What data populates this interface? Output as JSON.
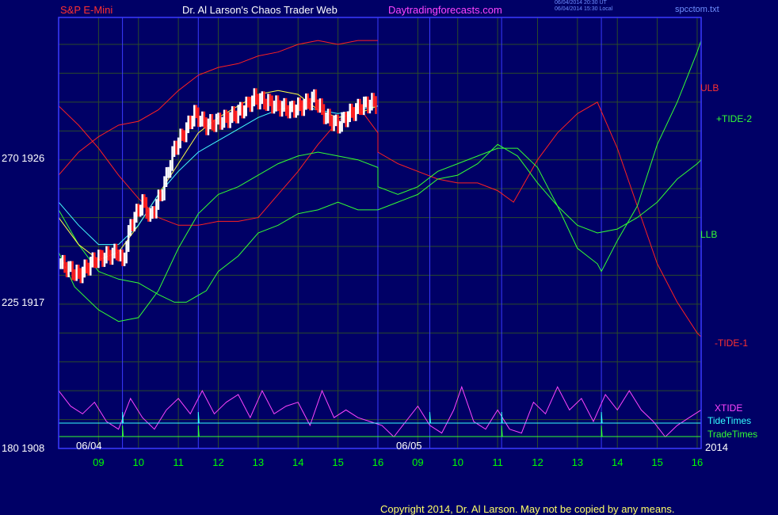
{
  "header": {
    "left_title": "S&P E-Mini",
    "center_title": "Dr. Al Larson's Chaos Trader Web",
    "site": "Daytradingforecasts.com",
    "timestamp_ut": "06/04/2014 20:30 UT",
    "timestamp_local": "06/04/2014 15:30 Local",
    "file": "spcctom.txt"
  },
  "labels": {
    "ulb": "ULB",
    "tide2": "+TIDE-2",
    "llb": "LLB",
    "tide1": "-TIDE-1",
    "xtide": "XTIDE",
    "tidetimes": "TideTimes",
    "tradetimes": "TradeTimes",
    "year": "2014",
    "date1": "06/04",
    "date2": "06/05"
  },
  "yaxis": [
    {
      "label": "270  1926",
      "value": 270
    },
    {
      "label": "225  1917",
      "value": 225
    },
    {
      "label": "180  1908",
      "value": 180
    }
  ],
  "copyright": "Copyright 2014, Dr. Al Larson. May not be copied by any means.",
  "colors": {
    "background": "#000066",
    "grid": "#2b4a2b",
    "frame": "#3a3aff",
    "ulb": "#ff2020",
    "tide2": "#33ff33",
    "llb": "#33ff33",
    "tide1": "#ff2020",
    "xtide": "#ff44ff",
    "tidetimes": "#33ffff",
    "tradetimes": "#33ff33",
    "price_up": "#ffffff",
    "price_down": "#ff2020",
    "ma_fast": "#ffff44",
    "ma_slow": "#44ffff"
  },
  "chart_data": {
    "type": "line",
    "title": "S&P E-Mini",
    "x_ticks": [
      "09",
      "10",
      "11",
      "12",
      "13",
      "14",
      "15",
      "16",
      "09",
      "10",
      "11",
      "12",
      "13",
      "14",
      "15",
      "16"
    ],
    "x_tick_hours": [
      9.0,
      10.0,
      11.0,
      12.0,
      13.0,
      14.0,
      15.0,
      16.0,
      17.0,
      18.0,
      19.0,
      20.0,
      21.0,
      22.0,
      23.0,
      24.0
    ],
    "x_range_hours": [
      8.0,
      24.1
    ],
    "y_range": [
      180,
      292
    ],
    "y_gridlines": [
      180,
      187.5,
      195,
      202.5,
      210,
      217.5,
      225,
      232.5,
      240,
      247.5,
      255,
      262.5,
      270,
      277.5,
      285
    ],
    "session_breaks_hours": [
      9.6,
      11.5,
      16.0,
      17.3,
      19.1,
      21.6
    ],
    "series": [
      {
        "name": "ULB",
        "key": "ulb",
        "points": [
          [
            8.0,
            269
          ],
          [
            8.5,
            264
          ],
          [
            9.0,
            258
          ],
          [
            9.5,
            251
          ],
          [
            10.0,
            245
          ],
          [
            10.5,
            240
          ],
          [
            11.0,
            238
          ],
          [
            11.5,
            238
          ],
          [
            12.0,
            239
          ],
          [
            12.5,
            239
          ],
          [
            13.0,
            240
          ],
          [
            13.5,
            246
          ],
          [
            14.0,
            252
          ],
          [
            14.5,
            259
          ],
          [
            15.0,
            265
          ],
          [
            15.5,
            269
          ],
          [
            16.0,
            262
          ],
          [
            16.0,
            257
          ],
          [
            16.5,
            254
          ],
          [
            17.0,
            252
          ],
          [
            17.5,
            250
          ],
          [
            18.0,
            249
          ],
          [
            18.5,
            249
          ],
          [
            19.0,
            247
          ],
          [
            19.4,
            244
          ],
          [
            20.0,
            255
          ],
          [
            20.5,
            262
          ],
          [
            21.0,
            267
          ],
          [
            21.5,
            270
          ],
          [
            22.0,
            258
          ],
          [
            22.5,
            243
          ],
          [
            23.0,
            228
          ],
          [
            23.5,
            218
          ],
          [
            24.0,
            210
          ],
          [
            24.1,
            209
          ]
        ]
      },
      {
        "name": "+TIDE-2",
        "key": "tide2",
        "points": [
          [
            8.0,
            231
          ],
          [
            8.4,
            222
          ],
          [
            9.0,
            216
          ],
          [
            9.5,
            213
          ],
          [
            10.0,
            214
          ],
          [
            10.5,
            221
          ],
          [
            11.0,
            232
          ],
          [
            11.5,
            241
          ],
          [
            12.0,
            246
          ],
          [
            12.5,
            248
          ],
          [
            13.0,
            251
          ],
          [
            13.5,
            254
          ],
          [
            14.0,
            256
          ],
          [
            14.5,
            257
          ],
          [
            15.0,
            256
          ],
          [
            15.5,
            255
          ],
          [
            16.0,
            253
          ],
          [
            16.0,
            248
          ],
          [
            16.5,
            246
          ],
          [
            17.0,
            248
          ],
          [
            17.5,
            252
          ],
          [
            18.0,
            254
          ],
          [
            18.5,
            256
          ],
          [
            19.0,
            258
          ],
          [
            19.5,
            258
          ],
          [
            20.0,
            253
          ],
          [
            20.5,
            243
          ],
          [
            21.0,
            232
          ],
          [
            21.5,
            228
          ],
          [
            21.6,
            226
          ],
          [
            22.0,
            234
          ],
          [
            22.5,
            243
          ],
          [
            23.0,
            259
          ],
          [
            23.5,
            270
          ],
          [
            24.0,
            283
          ],
          [
            24.1,
            286
          ]
        ]
      },
      {
        "name": "LLB",
        "key": "llb",
        "points": [
          [
            8.0,
            242
          ],
          [
            8.5,
            233
          ],
          [
            9.0,
            226
          ],
          [
            9.5,
            224
          ],
          [
            10.0,
            223
          ],
          [
            10.5,
            220
          ],
          [
            10.9,
            218
          ],
          [
            11.2,
            218
          ],
          [
            11.7,
            221
          ],
          [
            12.0,
            226
          ],
          [
            12.5,
            230
          ],
          [
            13.0,
            236
          ],
          [
            13.5,
            238
          ],
          [
            14.0,
            241
          ],
          [
            14.5,
            242
          ],
          [
            15.0,
            244
          ],
          [
            15.5,
            242
          ],
          [
            16.0,
            242
          ],
          [
            16.5,
            244
          ],
          [
            17.0,
            246
          ],
          [
            17.5,
            250
          ],
          [
            18.0,
            251
          ],
          [
            18.5,
            254
          ],
          [
            19.0,
            259
          ],
          [
            19.5,
            256
          ],
          [
            20.0,
            249
          ],
          [
            20.5,
            243
          ],
          [
            21.0,
            238
          ],
          [
            21.5,
            236
          ],
          [
            22.0,
            237
          ],
          [
            22.5,
            240
          ],
          [
            23.0,
            244
          ],
          [
            23.5,
            250
          ],
          [
            24.0,
            254
          ],
          [
            24.1,
            255
          ]
        ]
      },
      {
        "name": "-TIDE-1",
        "key": "tide1",
        "points": [
          [
            8.0,
            251
          ],
          [
            8.5,
            257
          ],
          [
            9.0,
            261
          ],
          [
            9.5,
            264
          ],
          [
            10.0,
            265
          ],
          [
            10.5,
            268
          ],
          [
            11.0,
            273
          ],
          [
            11.5,
            277
          ],
          [
            12.0,
            279
          ],
          [
            12.5,
            280
          ],
          [
            13.0,
            282
          ],
          [
            13.5,
            283
          ],
          [
            14.0,
            285
          ],
          [
            14.5,
            286
          ],
          [
            15.0,
            285
          ],
          [
            15.5,
            286
          ],
          [
            16.0,
            286
          ]
        ]
      },
      {
        "name": "MA fast",
        "key": "ma_fast",
        "points": [
          [
            8.0,
            240
          ],
          [
            8.5,
            233
          ],
          [
            9.0,
            229
          ],
          [
            9.5,
            231
          ],
          [
            10.0,
            238
          ],
          [
            10.5,
            246
          ],
          [
            11.0,
            254
          ],
          [
            11.5,
            262
          ],
          [
            12.0,
            266
          ],
          [
            12.5,
            269
          ],
          [
            13.0,
            272
          ],
          [
            13.5,
            273
          ],
          [
            14.0,
            272
          ],
          [
            14.5,
            268
          ],
          [
            15.0,
            266
          ],
          [
            15.5,
            267
          ],
          [
            16.0,
            269
          ]
        ]
      },
      {
        "name": "MA slow",
        "key": "ma_slow",
        "points": [
          [
            8.0,
            244
          ],
          [
            8.5,
            238
          ],
          [
            9.0,
            233
          ],
          [
            9.5,
            233
          ],
          [
            10.0,
            238
          ],
          [
            10.5,
            246
          ],
          [
            11.0,
            252
          ],
          [
            11.5,
            257
          ],
          [
            12.0,
            260
          ],
          [
            12.5,
            263
          ],
          [
            13.0,
            266
          ],
          [
            13.5,
            268
          ],
          [
            14.0,
            269
          ],
          [
            14.5,
            268
          ],
          [
            15.0,
            267
          ],
          [
            15.5,
            268
          ],
          [
            16.0,
            269
          ]
        ]
      }
    ],
    "xtide_points": [
      [
        8.0,
        195
      ],
      [
        8.3,
        191
      ],
      [
        8.6,
        189
      ],
      [
        8.9,
        192
      ],
      [
        9.2,
        187
      ],
      [
        9.5,
        185
      ],
      [
        9.8,
        193
      ],
      [
        10.1,
        188
      ],
      [
        10.4,
        185
      ],
      [
        10.7,
        190
      ],
      [
        11.0,
        193
      ],
      [
        11.3,
        189
      ],
      [
        11.6,
        195
      ],
      [
        11.9,
        189
      ],
      [
        12.2,
        192
      ],
      [
        12.5,
        194
      ],
      [
        12.8,
        188
      ],
      [
        13.1,
        195
      ],
      [
        13.4,
        189
      ],
      [
        13.7,
        191
      ],
      [
        14.0,
        192
      ],
      [
        14.3,
        186
      ],
      [
        14.6,
        195
      ],
      [
        14.9,
        188
      ],
      [
        15.2,
        190
      ],
      [
        15.5,
        188
      ],
      [
        15.8,
        187
      ],
      [
        16.1,
        186
      ],
      [
        16.4,
        183
      ],
      [
        16.7,
        187
      ],
      [
        17.0,
        191
      ],
      [
        17.3,
        186
      ],
      [
        17.6,
        184
      ],
      [
        17.9,
        190
      ],
      [
        18.1,
        196
      ],
      [
        18.4,
        187
      ],
      [
        18.7,
        185
      ],
      [
        19.0,
        190
      ],
      [
        19.3,
        185
      ],
      [
        19.6,
        184
      ],
      [
        19.9,
        192
      ],
      [
        20.2,
        189
      ],
      [
        20.5,
        196
      ],
      [
        20.8,
        190
      ],
      [
        21.1,
        193
      ],
      [
        21.4,
        187
      ],
      [
        21.7,
        194
      ],
      [
        22.0,
        190
      ],
      [
        22.3,
        195
      ],
      [
        22.6,
        190
      ],
      [
        22.9,
        187
      ],
      [
        23.2,
        183
      ],
      [
        23.5,
        186
      ],
      [
        23.8,
        188
      ],
      [
        24.1,
        190
      ]
    ],
    "tidetimes_hours": [
      9.6,
      11.5,
      17.3,
      19.1,
      21.6
    ],
    "tradetimes_hours": [
      9.6,
      11.5,
      19.1,
      21.6
    ],
    "price_path": [
      [
        8.05,
        228
      ],
      [
        8.5,
        225
      ],
      [
        8.9,
        229
      ],
      [
        9.2,
        230
      ],
      [
        9.5,
        231
      ],
      [
        9.6,
        228
      ],
      [
        9.8,
        238
      ],
      [
        10.1,
        244
      ],
      [
        10.3,
        240
      ],
      [
        10.6,
        247
      ],
      [
        10.9,
        258
      ],
      [
        11.2,
        263
      ],
      [
        11.4,
        267
      ],
      [
        11.7,
        264
      ],
      [
        12.0,
        265
      ],
      [
        12.3,
        266
      ],
      [
        12.6,
        268
      ],
      [
        12.9,
        271
      ],
      [
        13.2,
        270
      ],
      [
        13.5,
        269
      ],
      [
        13.8,
        268
      ],
      [
        14.1,
        269
      ],
      [
        14.4,
        271
      ],
      [
        14.7,
        266
      ],
      [
        15.0,
        264
      ],
      [
        15.3,
        267
      ],
      [
        15.6,
        269
      ],
      [
        15.9,
        270
      ],
      [
        16.0,
        269
      ]
    ]
  }
}
